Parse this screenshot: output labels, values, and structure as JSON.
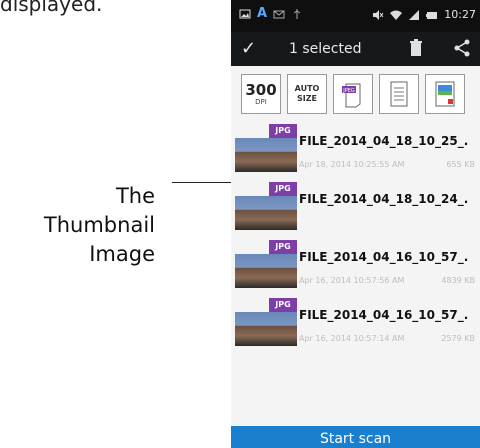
{
  "document": {
    "top_text": "displayed.",
    "callout": [
      "The",
      "Thumbnail",
      "Image"
    ]
  },
  "statusbar": {
    "time": "10:27"
  },
  "appbar": {
    "selected_label": "1 selected"
  },
  "toolbar": {
    "dpi_value": "300",
    "dpi_label": "DPI",
    "auto_size_line1": "AUTO",
    "auto_size_line2": "SIZE",
    "jpeg_label": "JPEG"
  },
  "files": [
    {
      "badge": "JPG",
      "name": "FILE_2014_04_18_10_25_.",
      "date": "Apr 18, 2014 10:25:55 AM",
      "size": "655 KB"
    },
    {
      "badge": "JPG",
      "name": "FILE_2014_04_18_10_24_.",
      "date": "",
      "size": ""
    },
    {
      "badge": "JPG",
      "name": "FILE_2014_04_16_10_57_.",
      "date": "Apr 16, 2014 10:57:56 AM",
      "size": "4839 KB"
    },
    {
      "badge": "JPG",
      "name": "FILE_2014_04_16_10_57_.",
      "date": "Apr 16, 2014 10:57:14 AM",
      "size": "2579 KB"
    }
  ],
  "start_scan_label": "Start scan",
  "colors": {
    "statusbar_bg": "#0f0f0f",
    "appbar_bg": "#16191c",
    "badge": "#7d3ea8",
    "start_bar": "#1a7fcf"
  }
}
